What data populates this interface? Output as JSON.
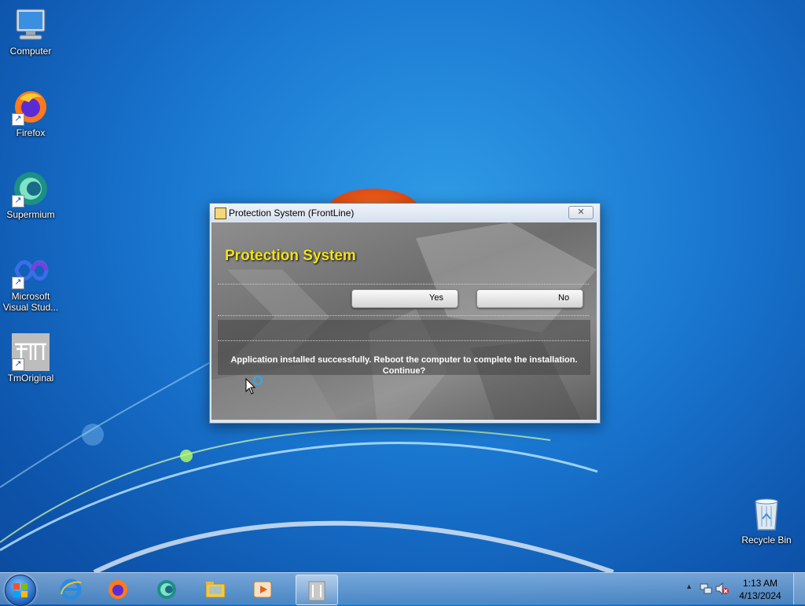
{
  "desktop": {
    "icons": [
      {
        "label": "Computer",
        "icon": "computer-icon"
      },
      {
        "label": "Firefox",
        "icon": "firefox-icon"
      },
      {
        "label": "Supermium",
        "icon": "supermium-icon"
      },
      {
        "label": "Microsoft Visual Stud...",
        "icon": "visual-studio-icon"
      },
      {
        "label": "TmOriginal",
        "icon": "tmoriginal-icon"
      },
      {
        "label": "Recycle Bin",
        "icon": "recycle-bin-icon"
      }
    ]
  },
  "dialog": {
    "title": "Protection System (FrontLine)",
    "close_glyph": "✕",
    "heading": "Protection System",
    "yes_label": "Yes",
    "no_label": "No",
    "message_line1": "Application installed successfully. Reboot the computer to complete the installation.",
    "message_line2": "Continue?",
    "heading_color": "#f2e21a"
  },
  "taskbar": {
    "items": [
      "start-button",
      "internet-explorer",
      "firefox",
      "supermium",
      "file-explorer",
      "media-player",
      "protection-system"
    ],
    "tray": {
      "time": "1:13 AM",
      "date": "4/13/2024",
      "show_hidden_glyph": "▲"
    }
  }
}
